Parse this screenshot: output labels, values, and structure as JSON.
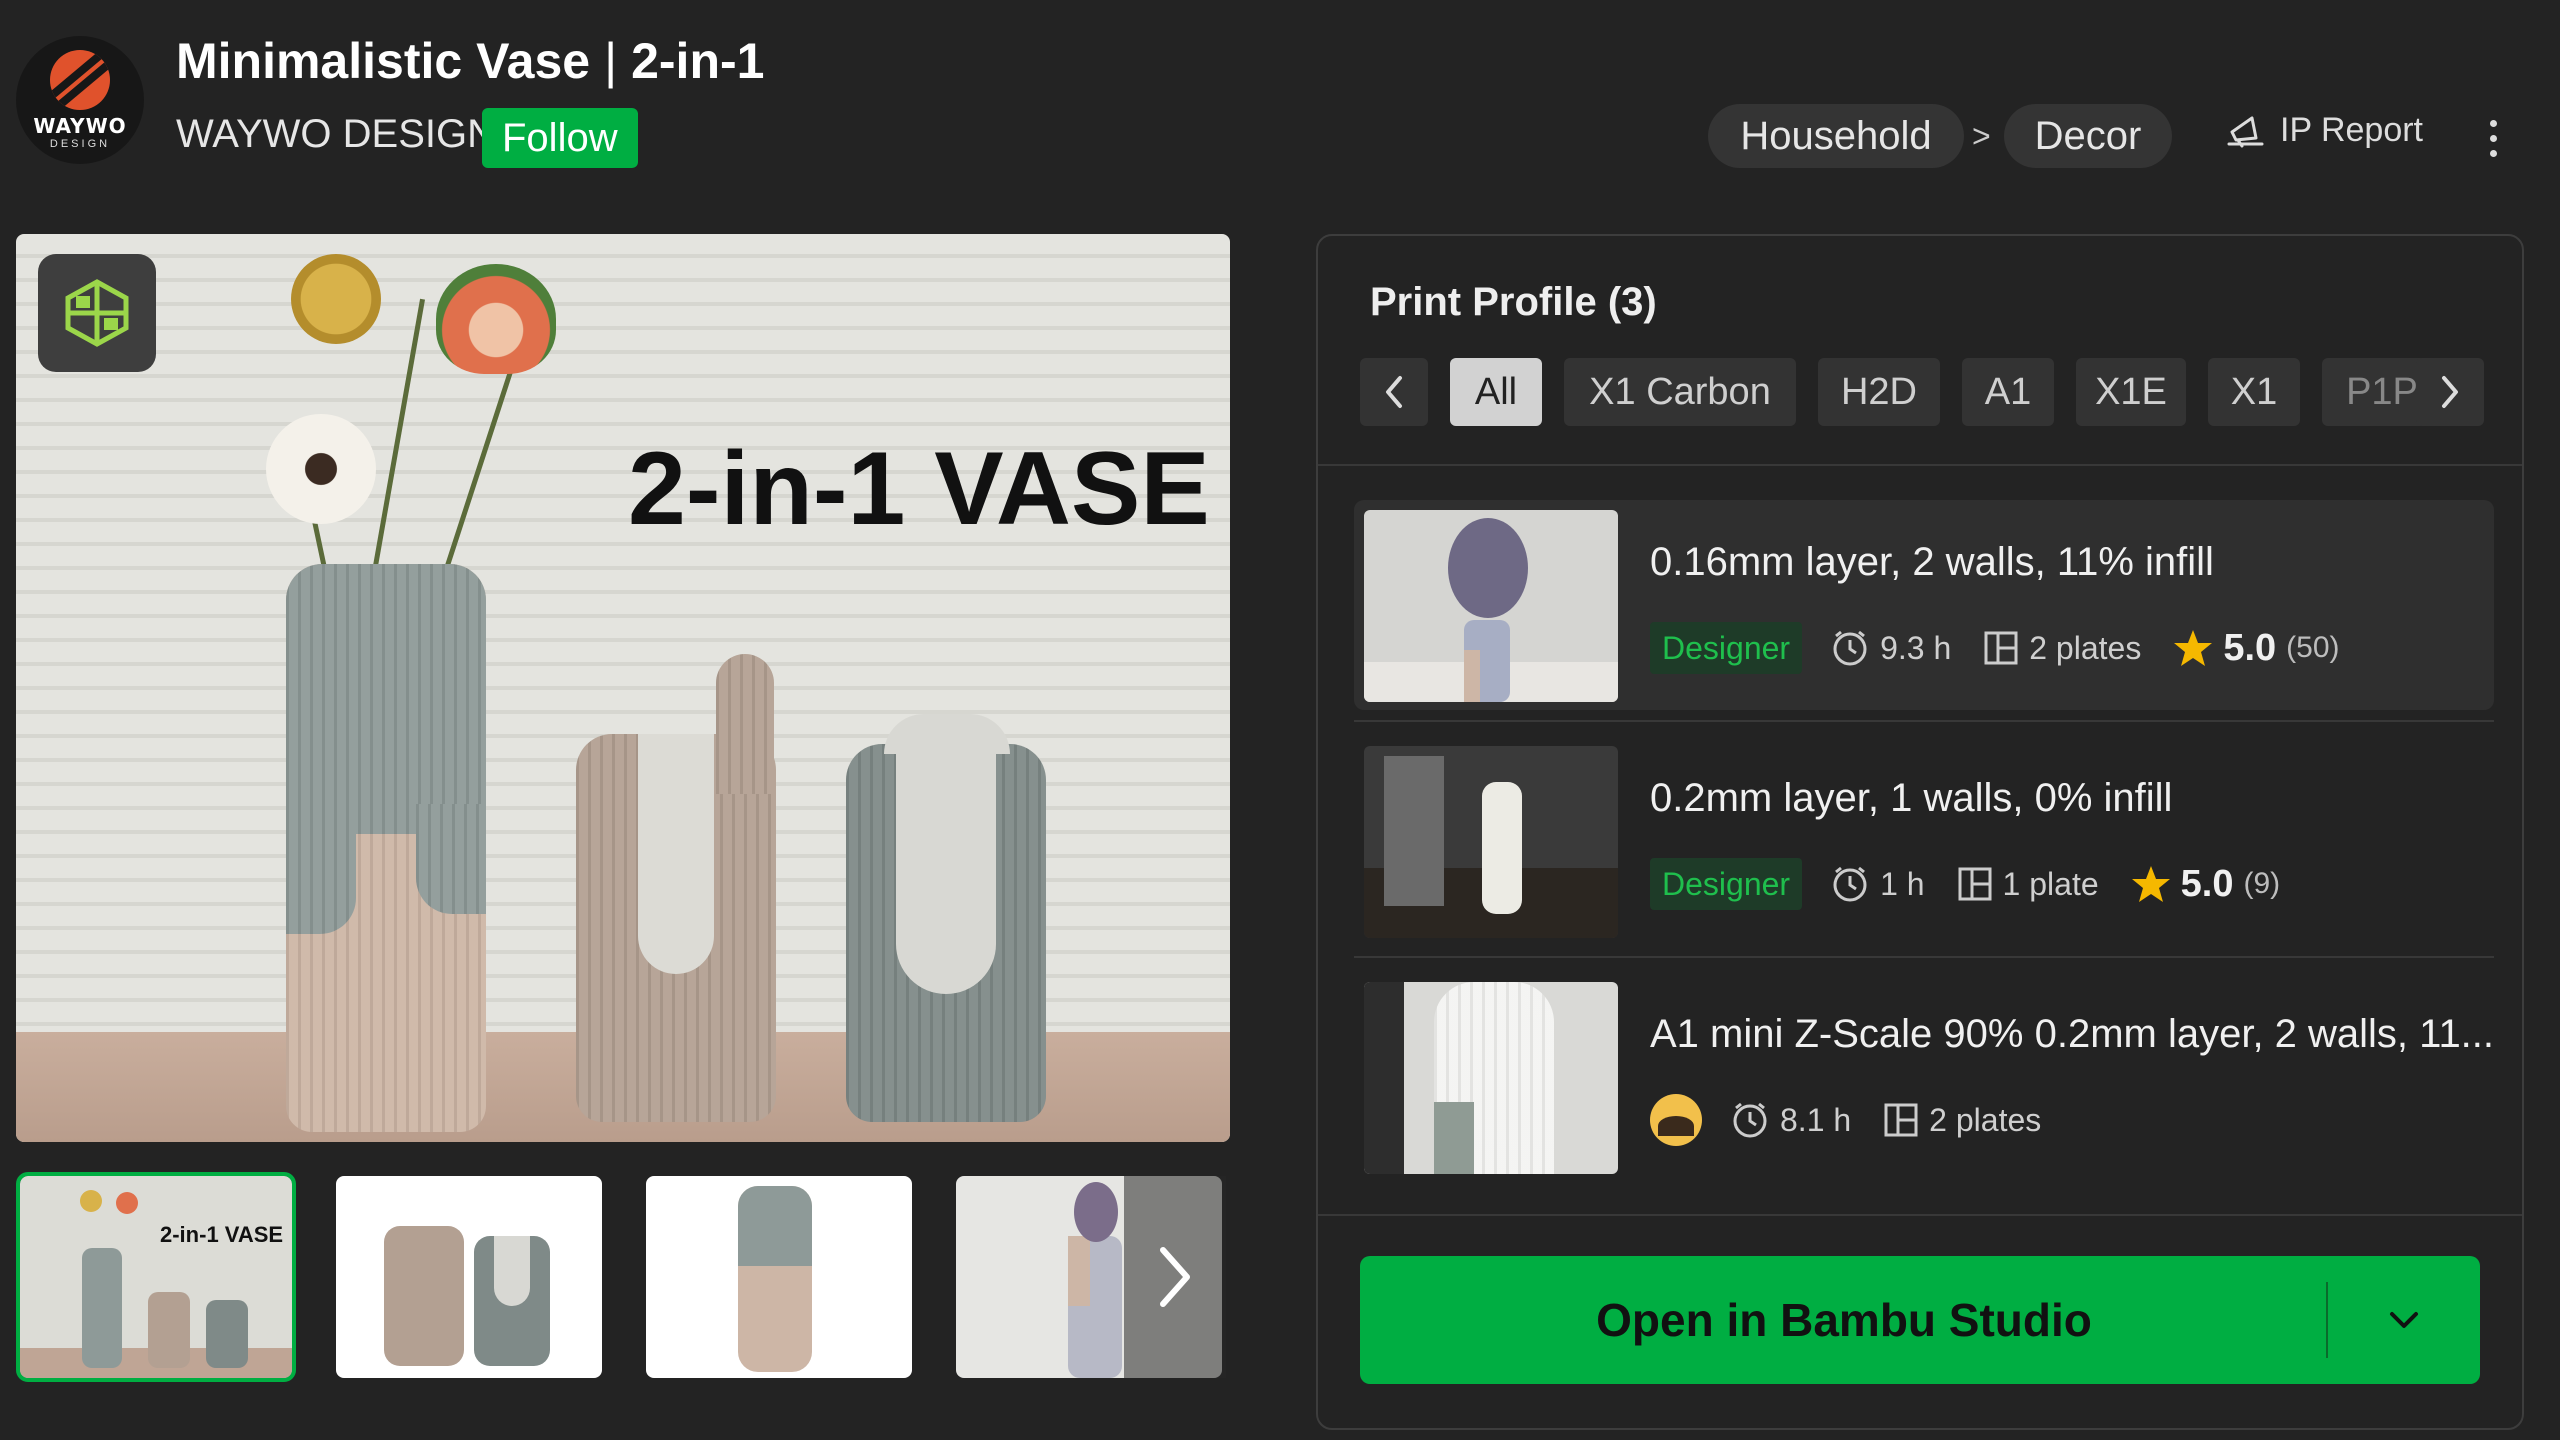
{
  "header": {
    "logo_text": "WAYWO",
    "logo_sub": "DESIGN",
    "title": "Minimalistic Vase",
    "title_sep": "|",
    "title_suffix": "2-in-1",
    "author": "WAYWO DESIGN",
    "follow_label": "Follow",
    "breadcrumb": [
      "Household",
      "Decor"
    ],
    "breadcrumb_sep": ">",
    "ip_report_label": "IP Report",
    "icons": {
      "ip_report": "megaphone-icon",
      "more": "more-vertical-icon"
    }
  },
  "hero": {
    "overlay_text": "2-in-1 VASE",
    "badge_icon": "cube-model-icon",
    "vases": [
      {
        "colors": [
          "#8e9a98",
          "#cdb6a6"
        ]
      },
      {
        "colors": [
          "#b3a092"
        ]
      },
      {
        "colors": [
          "#7f8a88",
          "#d8d8d3"
        ]
      }
    ]
  },
  "thumbnails": {
    "items": [
      {
        "label": "2-in-1 VASE",
        "active": true
      },
      {
        "label": "",
        "active": false
      },
      {
        "label": "",
        "active": false
      },
      {
        "label": "",
        "active": false
      }
    ],
    "next_icon": "chevron-right-icon"
  },
  "print_profile": {
    "title": "Print Profile (3)",
    "tabs": [
      "All",
      "X1 Carbon",
      "H2D",
      "A1",
      "X1E",
      "X1",
      "P1P"
    ],
    "active_tab": "All",
    "profiles": [
      {
        "title": "0.16mm layer, 2 walls, 11% infill",
        "badge": "Designer",
        "time": "9.3 h",
        "plates": "2 plates",
        "rating": "5.0",
        "rating_count": "(50)",
        "selected": true
      },
      {
        "title": "0.2mm layer, 1 walls, 0% infill",
        "badge": "Designer",
        "time": "1 h",
        "plates": "1 plate",
        "rating": "5.0",
        "rating_count": "(9)",
        "selected": false
      },
      {
        "title": "A1 mini Z-Scale 90% 0.2mm layer, 2 walls, 11...",
        "badge": "",
        "time": "8.1 h",
        "plates": "2 plates",
        "rating": "",
        "rating_count": "",
        "selected": false
      }
    ],
    "open_button_label": "Open in Bambu Studio",
    "colors": {
      "accent": "#00ae42",
      "star": "#f5b800",
      "designer": "#1fbf4d"
    }
  }
}
